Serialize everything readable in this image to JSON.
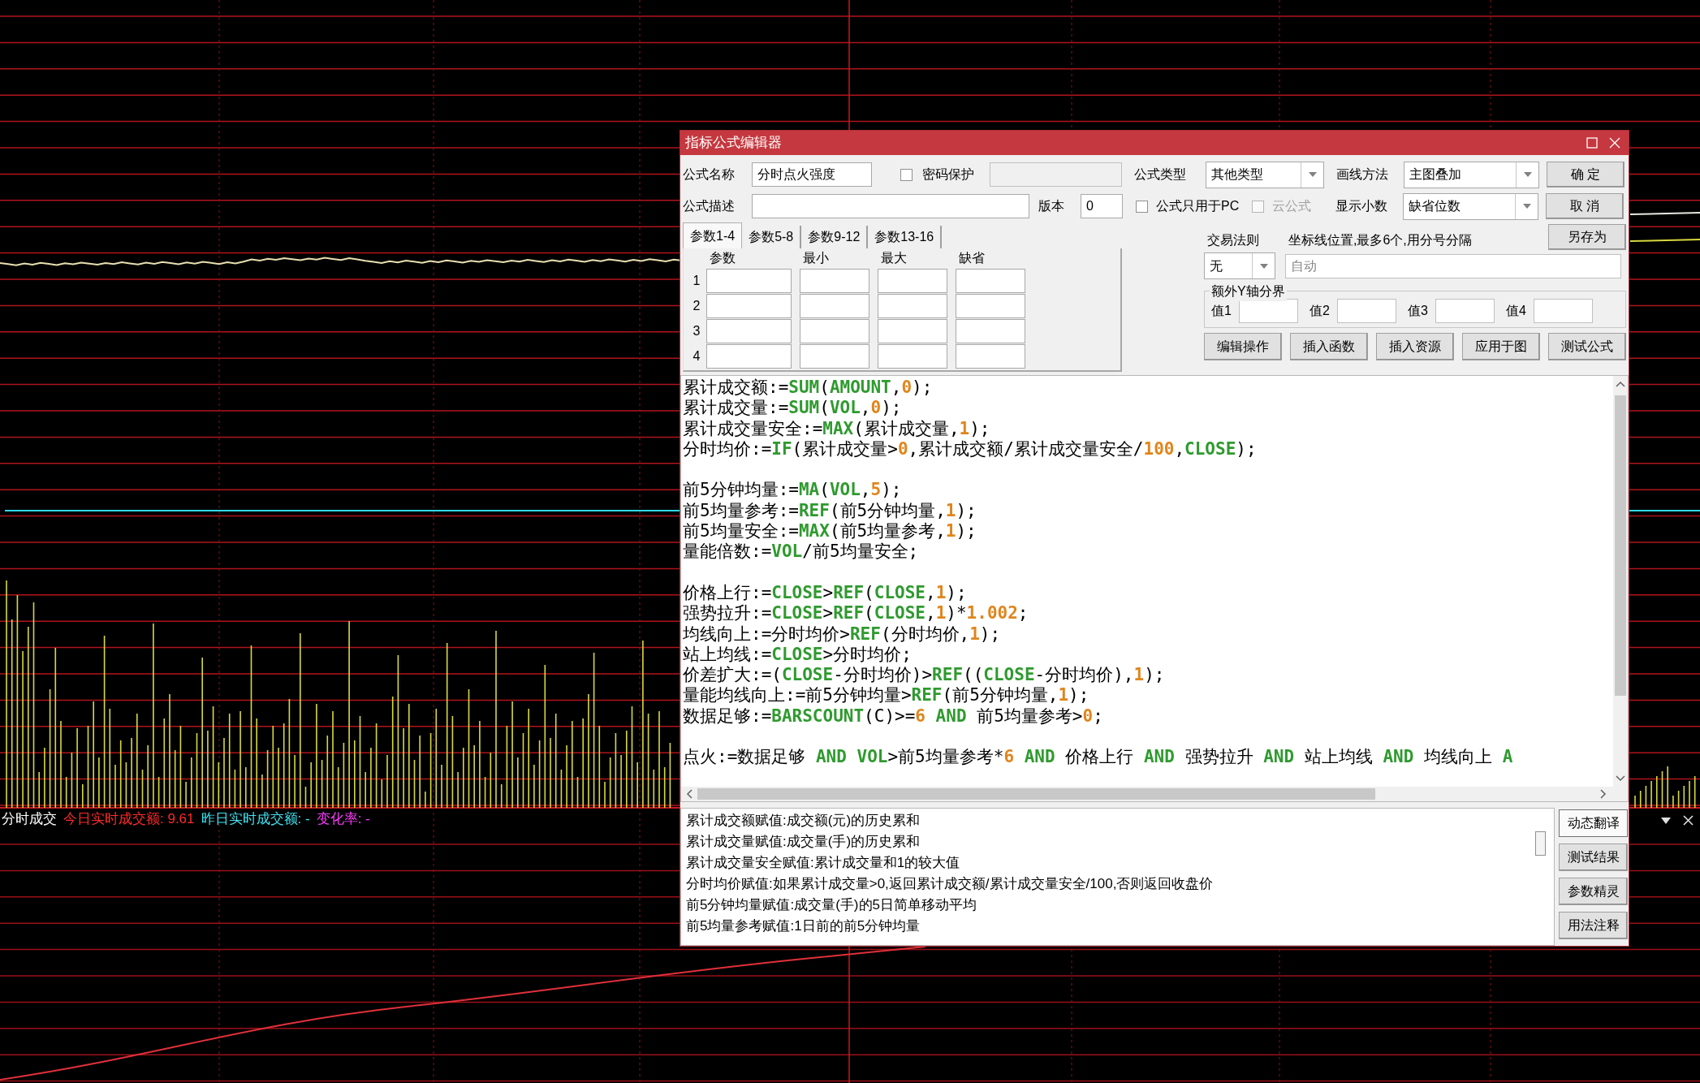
{
  "chart": {
    "legend": [
      {
        "text": "分时成交",
        "color": "#ffffff"
      },
      {
        "text": "今日实时成交额: 9.61",
        "color": "#ff2a2a"
      },
      {
        "text": "昨日实时成交额: -",
        "color": "#3fe0f0"
      },
      {
        "text": "变化率: -",
        "color": "#ff3cff"
      }
    ]
  },
  "dialog": {
    "title": "指标公式编辑器",
    "formula_name": {
      "label": "公式名称",
      "value": "分时点火强度"
    },
    "password": {
      "label": "密码保护",
      "checked": false
    },
    "formula_type": {
      "label": "公式类型",
      "value": "其他类型"
    },
    "draw_method": {
      "label": "画线方法",
      "value": "主图叠加"
    },
    "description": {
      "label": "公式描述"
    },
    "version": {
      "label": "版本",
      "value": "0"
    },
    "pc_only": {
      "label": "公式只用于PC",
      "checked": false
    },
    "cloud": {
      "label": "云公式",
      "checked": false,
      "disabled": true
    },
    "decimals": {
      "label": "显示小数",
      "value": "缺省位数"
    },
    "side_buttons": [
      "确 定",
      "取 消",
      "另存为"
    ],
    "param_tabs": [
      {
        "label": "参数1-4",
        "selected": true
      },
      {
        "label": "参数5-8",
        "selected": false
      },
      {
        "label": "参数9-12",
        "selected": false
      },
      {
        "label": "参数13-16",
        "selected": false
      }
    ],
    "param_columns": [
      "参数",
      "最小",
      "最大",
      "缺省"
    ],
    "param_rows": [
      "1",
      "2",
      "3",
      "4"
    ],
    "trade_rule": {
      "label": "交易法则",
      "value": "无"
    },
    "axis_lines": {
      "label": "坐标线位置,最多6个,用分号分隔",
      "placeholder": "自动"
    },
    "y_axis": {
      "title": "额外Y轴分界",
      "labels": [
        "值1",
        "值2",
        "值3",
        "值4"
      ]
    },
    "action_buttons": [
      "编辑操作",
      "插入函数",
      "插入资源",
      "应用于图",
      "测试公式"
    ],
    "code_lines": [
      {
        "kind": "code",
        "tokens": [
          {
            "kind": "text",
            "text": "累计成交额:="
          },
          {
            "kind": "func",
            "text": "SUM"
          },
          {
            "kind": "text",
            "text": "("
          },
          {
            "kind": "func",
            "text": "AMOUNT"
          },
          {
            "kind": "text",
            "text": ","
          },
          {
            "kind": "num",
            "text": "0"
          },
          {
            "kind": "text",
            "text": ");"
          }
        ]
      },
      {
        "kind": "code",
        "tokens": [
          {
            "kind": "text",
            "text": "累计成交量:="
          },
          {
            "kind": "func",
            "text": "SUM"
          },
          {
            "kind": "text",
            "text": "("
          },
          {
            "kind": "func",
            "text": "VOL"
          },
          {
            "kind": "text",
            "text": ","
          },
          {
            "kind": "num",
            "text": "0"
          },
          {
            "kind": "text",
            "text": ");"
          }
        ]
      },
      {
        "kind": "code",
        "tokens": [
          {
            "kind": "text",
            "text": "累计成交量安全:="
          },
          {
            "kind": "func",
            "text": "MAX"
          },
          {
            "kind": "text",
            "text": "(累计成交量,"
          },
          {
            "kind": "num",
            "text": "1"
          },
          {
            "kind": "text",
            "text": ");"
          }
        ]
      },
      {
        "kind": "code",
        "tokens": [
          {
            "kind": "text",
            "text": "分时均价:="
          },
          {
            "kind": "func",
            "text": "IF"
          },
          {
            "kind": "text",
            "text": "(累计成交量>"
          },
          {
            "kind": "num",
            "text": "0"
          },
          {
            "kind": "text",
            "text": ",累计成交额/累计成交量安全/"
          },
          {
            "kind": "num",
            "text": "100"
          },
          {
            "kind": "text",
            "text": ","
          },
          {
            "kind": "func",
            "text": "CLOSE"
          },
          {
            "kind": "text",
            "text": ");"
          }
        ]
      },
      {
        "kind": "blank"
      },
      {
        "kind": "code",
        "tokens": [
          {
            "kind": "text",
            "text": "前5分钟均量:="
          },
          {
            "kind": "func",
            "text": "MA"
          },
          {
            "kind": "text",
            "text": "("
          },
          {
            "kind": "func",
            "text": "VOL"
          },
          {
            "kind": "text",
            "text": ","
          },
          {
            "kind": "num",
            "text": "5"
          },
          {
            "kind": "text",
            "text": ");"
          }
        ]
      },
      {
        "kind": "code",
        "tokens": [
          {
            "kind": "text",
            "text": "前5均量参考:="
          },
          {
            "kind": "func",
            "text": "REF"
          },
          {
            "kind": "text",
            "text": "(前5分钟均量,"
          },
          {
            "kind": "num",
            "text": "1"
          },
          {
            "kind": "text",
            "text": ");"
          }
        ]
      },
      {
        "kind": "code",
        "tokens": [
          {
            "kind": "text",
            "text": "前5均量安全:="
          },
          {
            "kind": "func",
            "text": "MAX"
          },
          {
            "kind": "text",
            "text": "(前5均量参考,"
          },
          {
            "kind": "num",
            "text": "1"
          },
          {
            "kind": "text",
            "text": ");"
          }
        ]
      },
      {
        "kind": "code",
        "tokens": [
          {
            "kind": "text",
            "text": "量能倍数:="
          },
          {
            "kind": "func",
            "text": "VOL"
          },
          {
            "kind": "text",
            "text": "/前5均量安全;"
          }
        ]
      },
      {
        "kind": "blank"
      },
      {
        "kind": "code",
        "tokens": [
          {
            "kind": "text",
            "text": "价格上行:="
          },
          {
            "kind": "func",
            "text": "CLOSE"
          },
          {
            "kind": "text",
            "text": ">"
          },
          {
            "kind": "func",
            "text": "REF"
          },
          {
            "kind": "text",
            "text": "("
          },
          {
            "kind": "func",
            "text": "CLOSE"
          },
          {
            "kind": "text",
            "text": ","
          },
          {
            "kind": "num",
            "text": "1"
          },
          {
            "kind": "text",
            "text": ");"
          }
        ]
      },
      {
        "kind": "code",
        "tokens": [
          {
            "kind": "text",
            "text": "强势拉升:="
          },
          {
            "kind": "func",
            "text": "CLOSE"
          },
          {
            "kind": "text",
            "text": ">"
          },
          {
            "kind": "func",
            "text": "REF"
          },
          {
            "kind": "text",
            "text": "("
          },
          {
            "kind": "func",
            "text": "CLOSE"
          },
          {
            "kind": "text",
            "text": ","
          },
          {
            "kind": "num",
            "text": "1"
          },
          {
            "kind": "text",
            "text": ")*"
          },
          {
            "kind": "num",
            "text": "1.002"
          },
          {
            "kind": "text",
            "text": ";"
          }
        ]
      },
      {
        "kind": "code",
        "tokens": [
          {
            "kind": "text",
            "text": "均线向上:=分时均价>"
          },
          {
            "kind": "func",
            "text": "REF"
          },
          {
            "kind": "text",
            "text": "(分时均价,"
          },
          {
            "kind": "num",
            "text": "1"
          },
          {
            "kind": "text",
            "text": ");"
          }
        ]
      },
      {
        "kind": "code",
        "tokens": [
          {
            "kind": "text",
            "text": "站上均线:="
          },
          {
            "kind": "func",
            "text": "CLOSE"
          },
          {
            "kind": "text",
            "text": ">分时均价;"
          }
        ]
      },
      {
        "kind": "code",
        "tokens": [
          {
            "kind": "text",
            "text": "价差扩大:=("
          },
          {
            "kind": "func",
            "text": "CLOSE"
          },
          {
            "kind": "text",
            "text": "-分时均价)>"
          },
          {
            "kind": "func",
            "text": "REF"
          },
          {
            "kind": "text",
            "text": "(("
          },
          {
            "kind": "func",
            "text": "CLOSE"
          },
          {
            "kind": "text",
            "text": "-分时均价),"
          },
          {
            "kind": "num",
            "text": "1"
          },
          {
            "kind": "text",
            "text": ");"
          }
        ]
      },
      {
        "kind": "code",
        "tokens": [
          {
            "kind": "text",
            "text": "量能均线向上:=前5分钟均量>"
          },
          {
            "kind": "func",
            "text": "REF"
          },
          {
            "kind": "text",
            "text": "(前5分钟均量,"
          },
          {
            "kind": "num",
            "text": "1"
          },
          {
            "kind": "text",
            "text": ");"
          }
        ]
      },
      {
        "kind": "code",
        "tokens": [
          {
            "kind": "text",
            "text": "数据足够:="
          },
          {
            "kind": "func",
            "text": "BARSCOUNT"
          },
          {
            "kind": "text",
            "text": "(C)>="
          },
          {
            "kind": "num",
            "text": "6"
          },
          {
            "kind": "func",
            "text": " AND"
          },
          {
            "kind": "text",
            "text": " 前5均量参考>"
          },
          {
            "kind": "num",
            "text": "0"
          },
          {
            "kind": "text",
            "text": ";"
          }
        ]
      },
      {
        "kind": "blank"
      },
      {
        "kind": "code",
        "tokens": [
          {
            "kind": "text",
            "text": "点火:=数据足够 "
          },
          {
            "kind": "func",
            "text": "AND VOL"
          },
          {
            "kind": "text",
            "text": ">前5均量参考*"
          },
          {
            "kind": "num",
            "text": "6"
          },
          {
            "kind": "func",
            "text": " AND"
          },
          {
            "kind": "text",
            "text": " 价格上行 "
          },
          {
            "kind": "func",
            "text": "AND"
          },
          {
            "kind": "text",
            "text": " 强势拉升 "
          },
          {
            "kind": "func",
            "text": "AND"
          },
          {
            "kind": "text",
            "text": " 站上均线 "
          },
          {
            "kind": "func",
            "text": "AND"
          },
          {
            "kind": "text",
            "text": " 均线向上 "
          },
          {
            "kind": "func",
            "text": "A"
          }
        ]
      }
    ],
    "output_lines": [
      "累计成交额赋值:成交额(元)的历史累和",
      "累计成交量赋值:成交量(手)的历史累和",
      "累计成交量安全赋值:累计成交量和1的较大值",
      "分时均价赋值:如果累计成交量>0,返回累计成交额/累计成交量安全/100,否则返回收盘价",
      "前5分钟均量赋值:成交量(手)的5日简单移动平均",
      "前5均量参考赋值:1日前的前5分钟均量"
    ],
    "output_buttons": [
      {
        "label": "动态翻译",
        "selected": true
      },
      {
        "label": "测试结果",
        "selected": false
      },
      {
        "label": "参数精灵",
        "selected": false
      },
      {
        "label": "用法注释",
        "selected": false
      }
    ]
  }
}
